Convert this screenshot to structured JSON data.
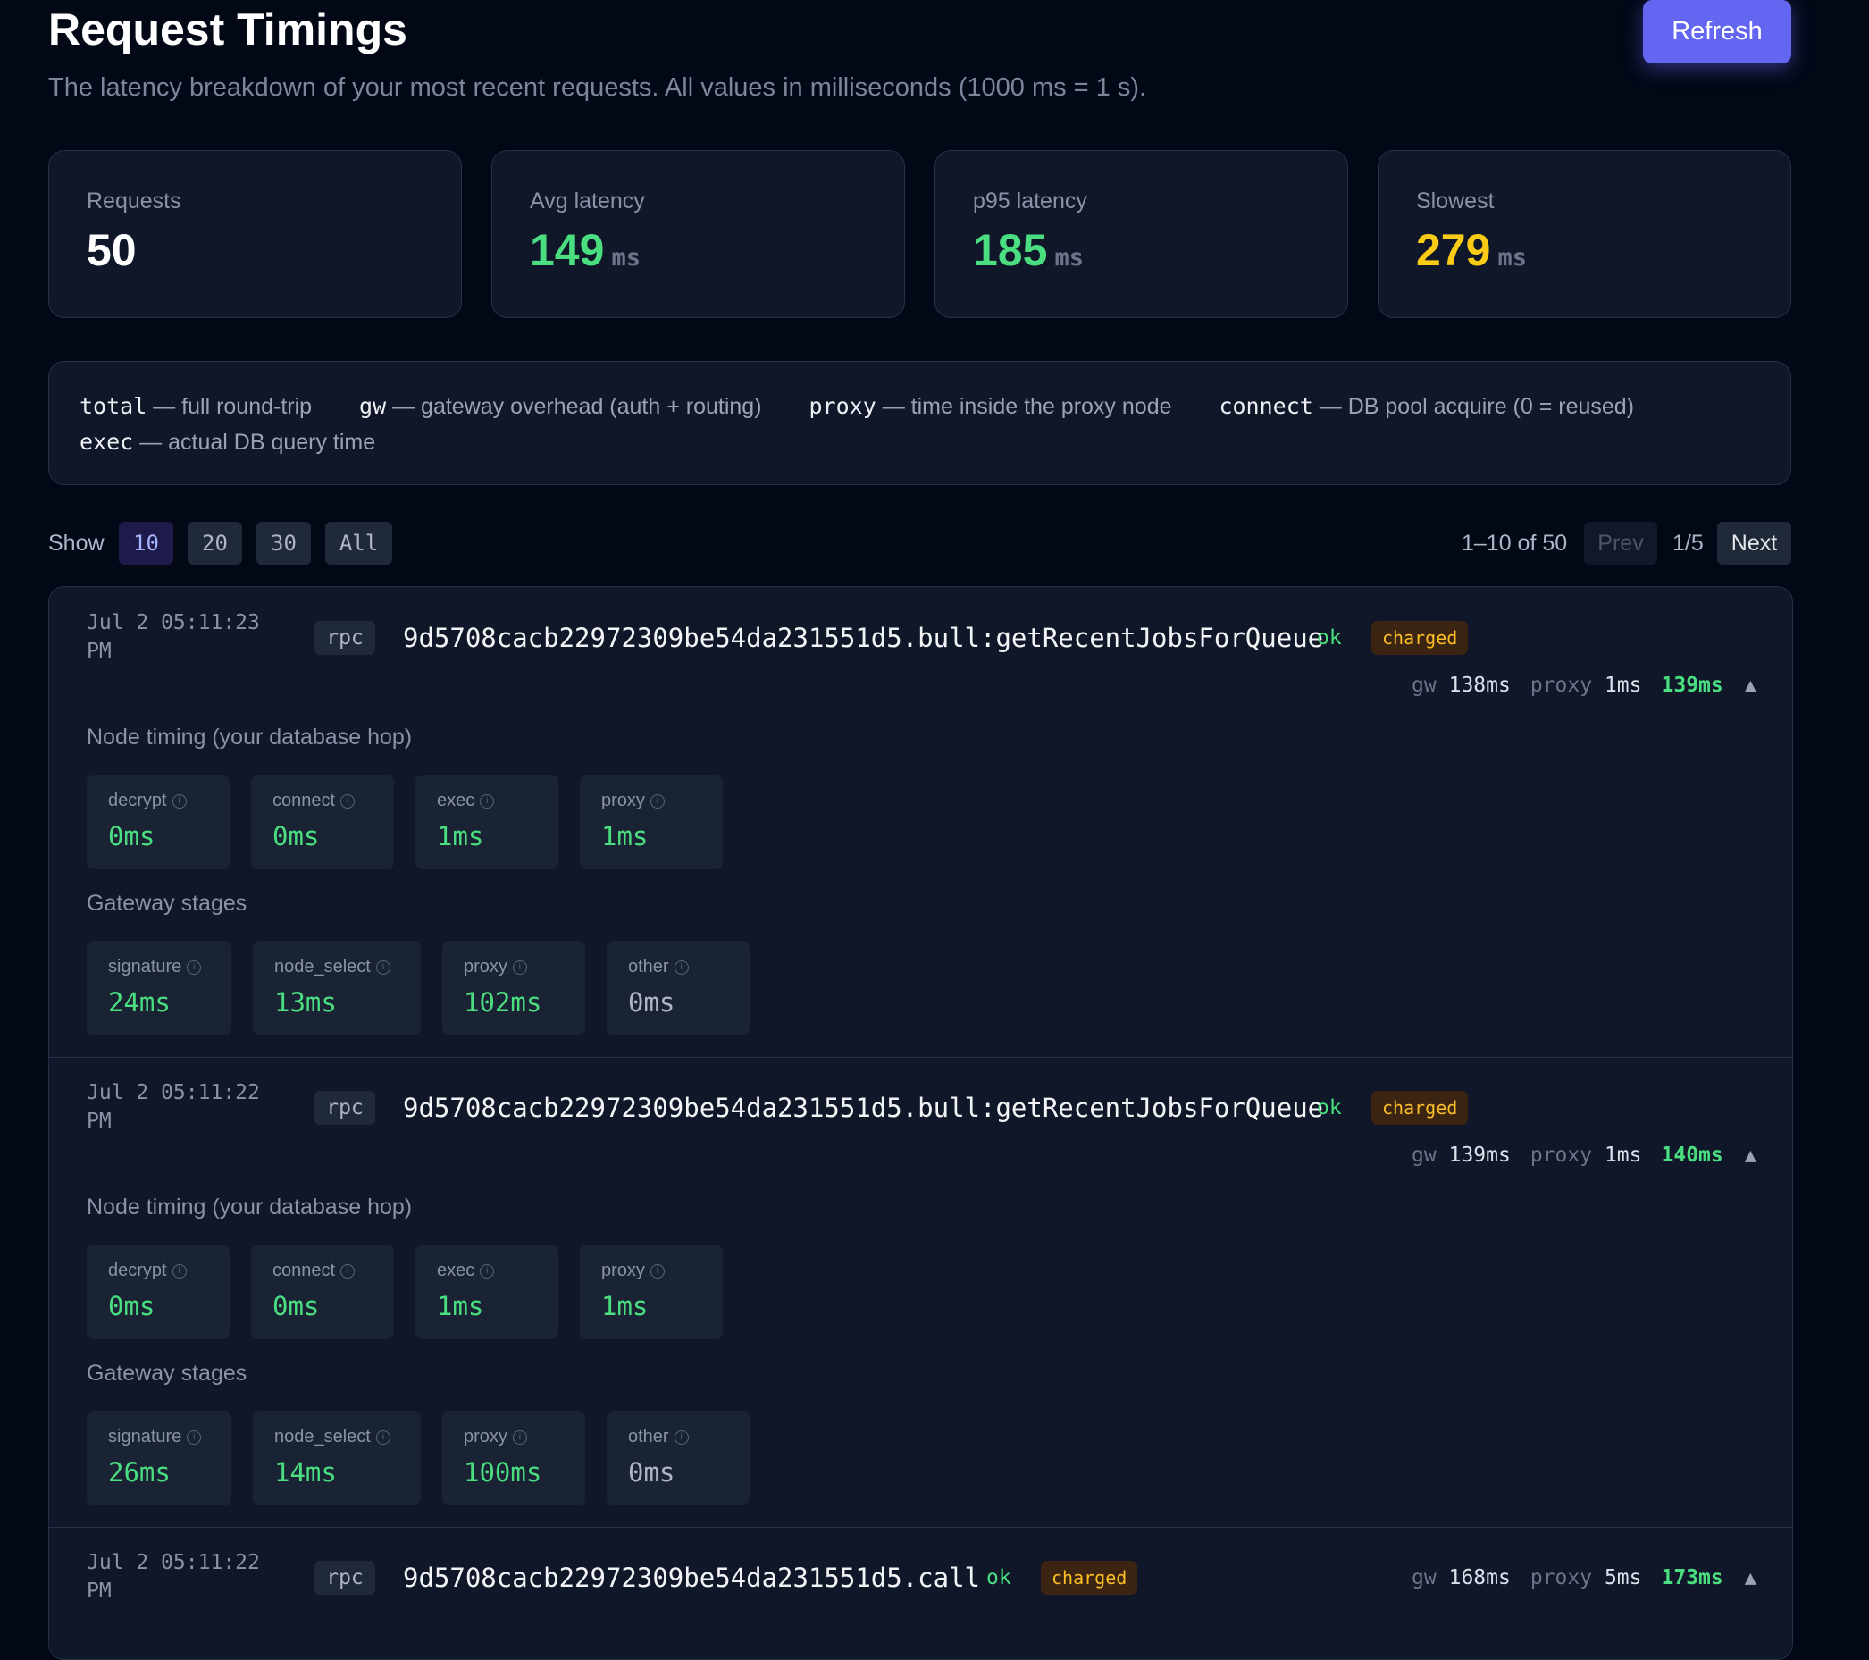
{
  "header": {
    "title": "Request Timings",
    "subtitle": "The latency breakdown of your most recent requests. All values in milliseconds (1000 ms = 1 s).",
    "refresh_label": "Refresh"
  },
  "stats": [
    {
      "label": "Requests",
      "value": "50",
      "unit": "",
      "color": "#ffffff"
    },
    {
      "label": "Avg latency",
      "value": "149",
      "unit": "ms",
      "color": "#4ade80"
    },
    {
      "label": "p95 latency",
      "value": "185",
      "unit": "ms",
      "color": "#4ade80"
    },
    {
      "label": "Slowest",
      "value": "279",
      "unit": "ms",
      "color": "#facc15"
    }
  ],
  "legend": [
    {
      "key": "total",
      "desc": "— full round-trip"
    },
    {
      "key": "gw",
      "desc": "— gateway overhead (auth + routing)"
    },
    {
      "key": "proxy",
      "desc": "— time inside the proxy node"
    },
    {
      "key": "connect",
      "desc": "— DB pool acquire (0 = reused)"
    },
    {
      "key": "exec",
      "desc": "— actual DB query time"
    }
  ],
  "toolbar": {
    "show_label": "Show",
    "page_sizes": [
      "10",
      "20",
      "30",
      "All"
    ],
    "active_page_size": "10",
    "range_text": "1–10 of 50",
    "prev_label": "Prev",
    "page_indicator": "1/5",
    "next_label": "Next"
  },
  "requests": [
    {
      "timestamp_line1": "Jul 2 05:11:23",
      "timestamp_line2": "PM",
      "kind": "rpc",
      "target": "9d5708cacb22972309be54da231551d5.bull:getRecentJobsForQueue",
      "status": "ok",
      "badge": "charged",
      "gw_label": "gw",
      "gw": "138ms",
      "proxy_label": "proxy",
      "proxy": "1ms",
      "total": "139ms",
      "expanded_icon": "chevron-up-icon",
      "node_title": "Node timing (your database hop)",
      "node": [
        {
          "label": "decrypt",
          "value": "0ms"
        },
        {
          "label": "connect",
          "value": "0ms"
        },
        {
          "label": "exec",
          "value": "1ms"
        },
        {
          "label": "proxy",
          "value": "1ms"
        }
      ],
      "gateway_title": "Gateway stages",
      "gateway": [
        {
          "label": "signature",
          "value": "24ms"
        },
        {
          "label": "node_select",
          "value": "13ms"
        },
        {
          "label": "proxy",
          "value": "102ms"
        },
        {
          "label": "other",
          "value": "0ms"
        }
      ]
    },
    {
      "timestamp_line1": "Jul 2 05:11:22",
      "timestamp_line2": "PM",
      "kind": "rpc",
      "target": "9d5708cacb22972309be54da231551d5.bull:getRecentJobsForQueue",
      "status": "ok",
      "badge": "charged",
      "gw_label": "gw",
      "gw": "139ms",
      "proxy_label": "proxy",
      "proxy": "1ms",
      "total": "140ms",
      "expanded_icon": "chevron-up-icon",
      "node_title": "Node timing (your database hop)",
      "node": [
        {
          "label": "decrypt",
          "value": "0ms"
        },
        {
          "label": "connect",
          "value": "0ms"
        },
        {
          "label": "exec",
          "value": "1ms"
        },
        {
          "label": "proxy",
          "value": "1ms"
        }
      ],
      "gateway_title": "Gateway stages",
      "gateway": [
        {
          "label": "signature",
          "value": "26ms"
        },
        {
          "label": "node_select",
          "value": "14ms"
        },
        {
          "label": "proxy",
          "value": "100ms"
        },
        {
          "label": "other",
          "value": "0ms"
        }
      ]
    },
    {
      "timestamp_line1": "Jul 2 05:11:22",
      "timestamp_line2": "PM",
      "kind": "rpc",
      "target": "9d5708cacb22972309be54da231551d5.call",
      "status": "ok",
      "badge": "charged",
      "gw_label": "gw",
      "gw": "168ms",
      "proxy_label": "proxy",
      "proxy": "5ms",
      "total": "173ms",
      "expanded_icon": "chevron-up-icon"
    }
  ],
  "colors": {
    "accent": "#6366f1",
    "ok": "#4ade80",
    "warn": "#facc15",
    "badge_bg": "#3b2412",
    "badge_fg": "#fbbf24"
  }
}
